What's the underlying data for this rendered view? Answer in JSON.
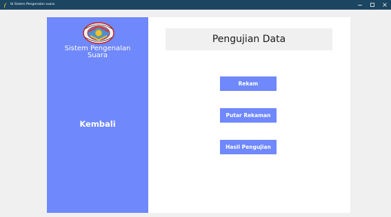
{
  "window": {
    "title": "tk Sistem Pengenalan suara",
    "controls": {
      "minimize": "–",
      "maximize": "□",
      "close": "✕"
    }
  },
  "sidebar": {
    "app_title_line1": "Sistem Pengenalan",
    "app_title_line2": "Suara",
    "back_label": "Kembali"
  },
  "main": {
    "header": "Pengujian Data",
    "buttons": [
      "Rekam",
      "Putar Rekaman",
      "Hasil Pengujian"
    ]
  },
  "colors": {
    "titlebar": "#1b4560",
    "accent": "#6f88fb",
    "panel": "#ffffff",
    "header_box": "#f0f0f0"
  }
}
